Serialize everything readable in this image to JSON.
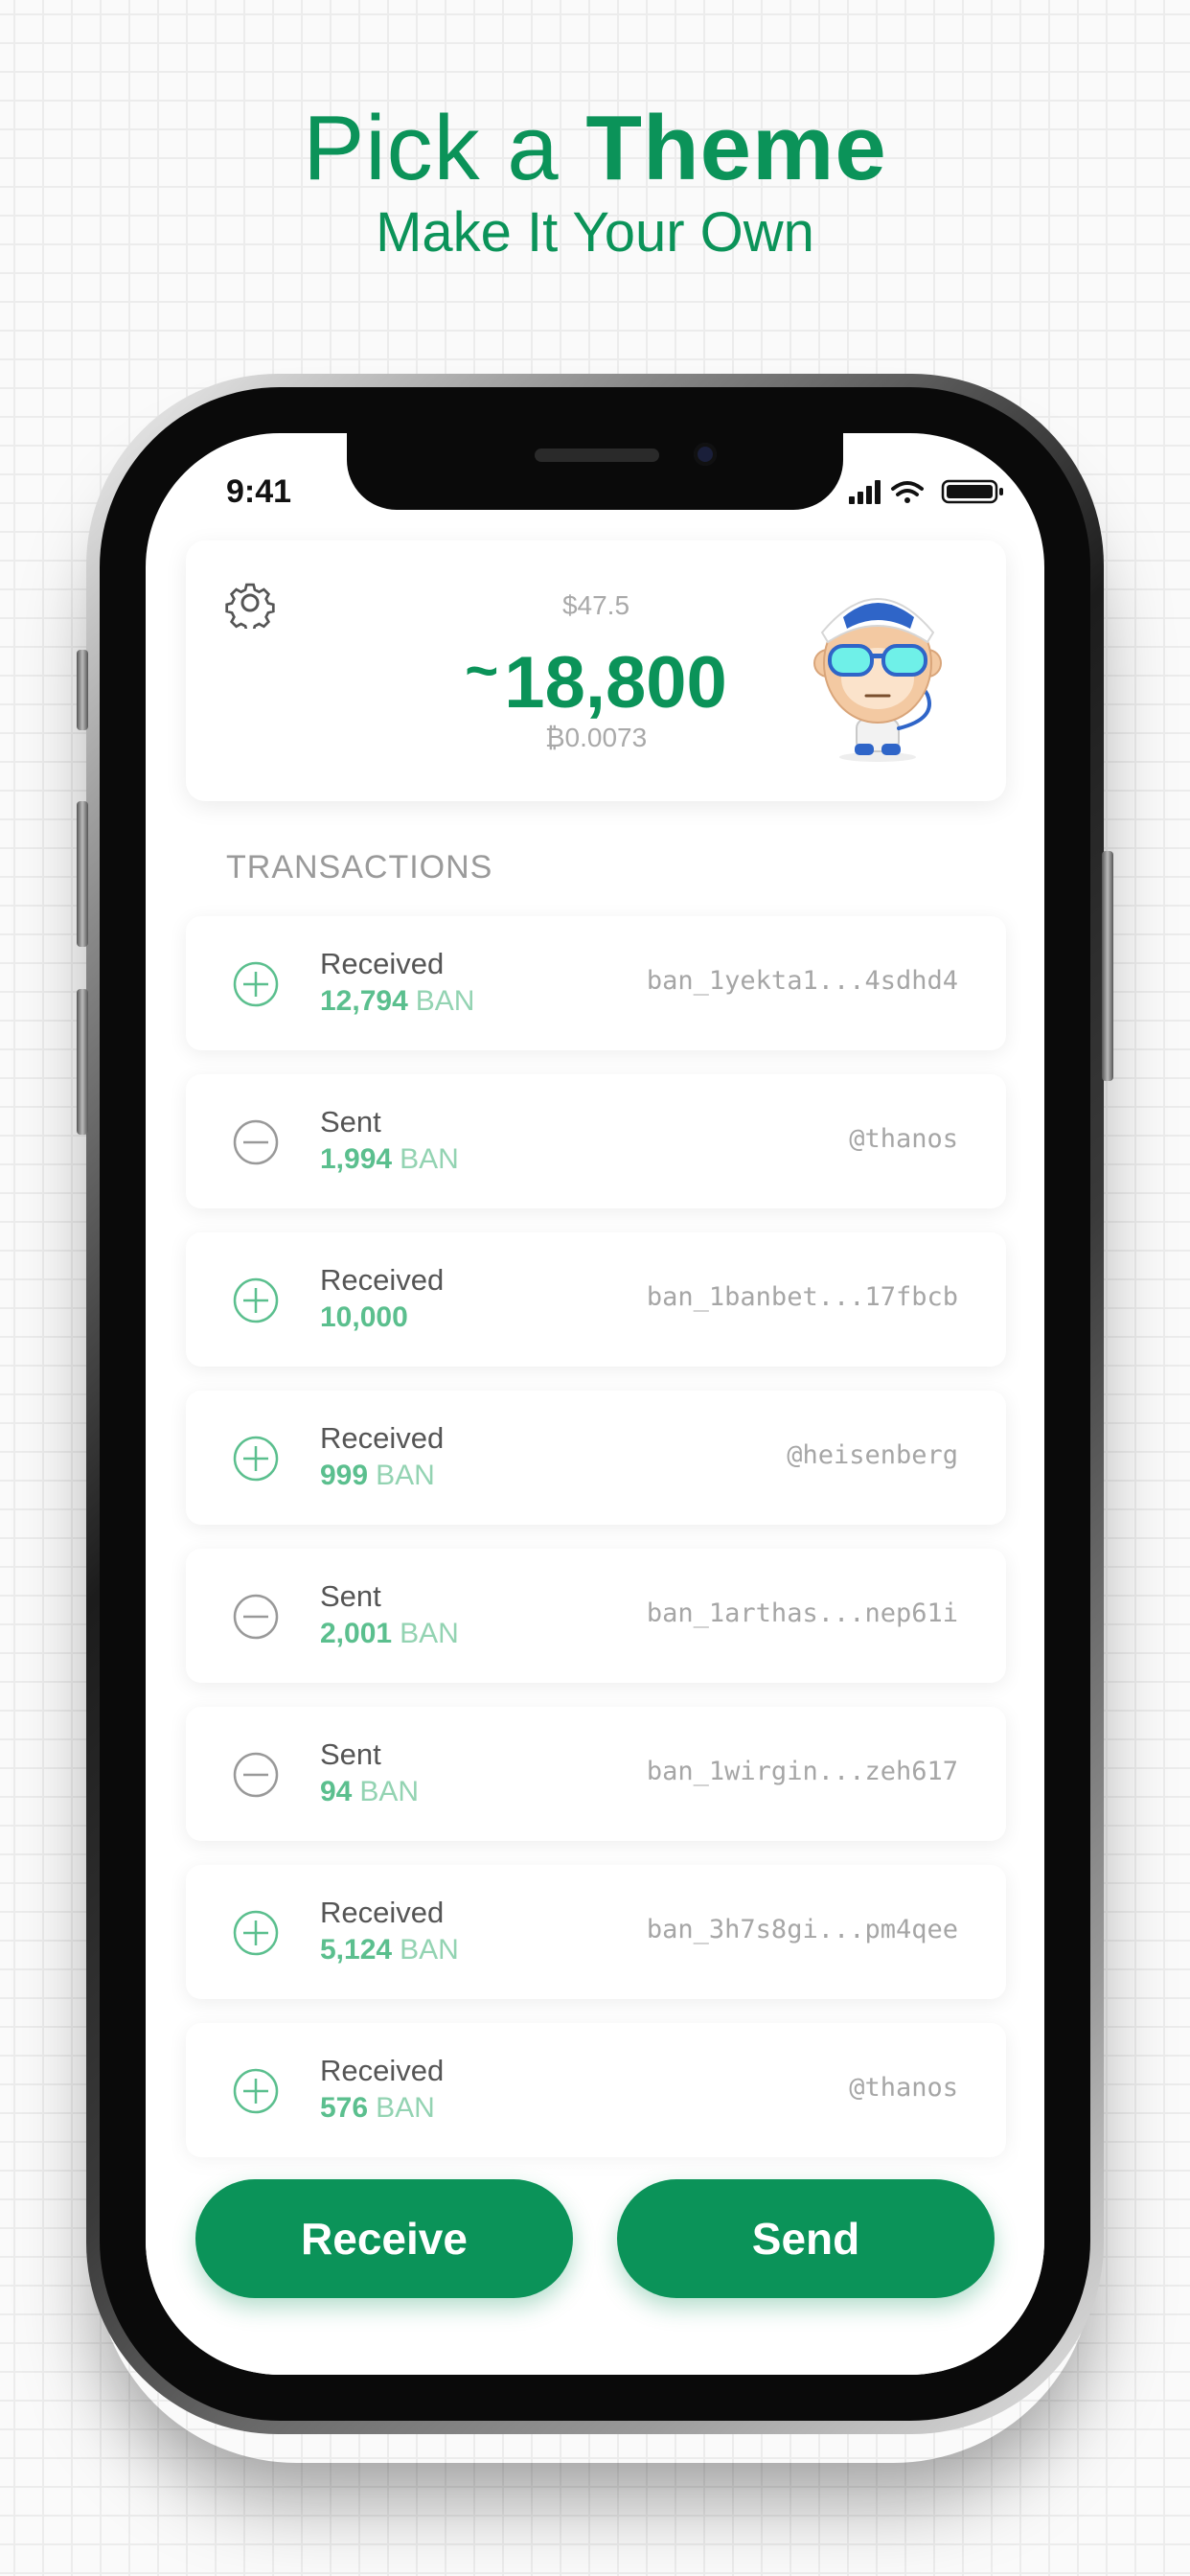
{
  "headline": {
    "light": "Pick a",
    "bold": "Theme"
  },
  "subheadline": "Make It Your Own",
  "status_bar": {
    "time": "9:41"
  },
  "balance_card": {
    "fiat_value": "$47.5",
    "amount_prefix": "~",
    "amount": "18,800",
    "btc_value": "₿0.0073",
    "settings_icon": "gear-icon",
    "avatar": "monkey-avatar"
  },
  "transactions_header": "TRANSACTIONS",
  "transactions": [
    {
      "type": "Received",
      "amount": "12,794",
      "unit": "BAN",
      "address": "ban_1yekta1...4sdhd4",
      "icon": "plus-circle-icon"
    },
    {
      "type": "Sent",
      "amount": "1,994",
      "unit": "BAN",
      "address": "@thanos",
      "icon": "minus-circle-icon"
    },
    {
      "type": "Received",
      "amount": "10,000",
      "unit": "",
      "address": "ban_1banbet...17fbcb",
      "icon": "plus-circle-icon"
    },
    {
      "type": "Received",
      "amount": "999",
      "unit": "BAN",
      "address": "@heisenberg",
      "icon": "plus-circle-icon"
    },
    {
      "type": "Sent",
      "amount": "2,001",
      "unit": "BAN",
      "address": "ban_1arthas...nep61i",
      "icon": "minus-circle-icon"
    },
    {
      "type": "Sent",
      "amount": "94",
      "unit": "BAN",
      "address": "ban_1wirgin...zeh617",
      "icon": "minus-circle-icon"
    },
    {
      "type": "Received",
      "amount": "5,124",
      "unit": "BAN",
      "address": "ban_3h7s8gi...pm4qee",
      "icon": "plus-circle-icon"
    },
    {
      "type": "Received",
      "amount": "576",
      "unit": "BAN",
      "address": "@thanos",
      "icon": "plus-circle-icon"
    }
  ],
  "actions": {
    "receive_label": "Receive",
    "send_label": "Send"
  },
  "colors": {
    "accent": "#0b9359",
    "amount_green": "#5bbf8e",
    "sent_icon": "#999999"
  }
}
